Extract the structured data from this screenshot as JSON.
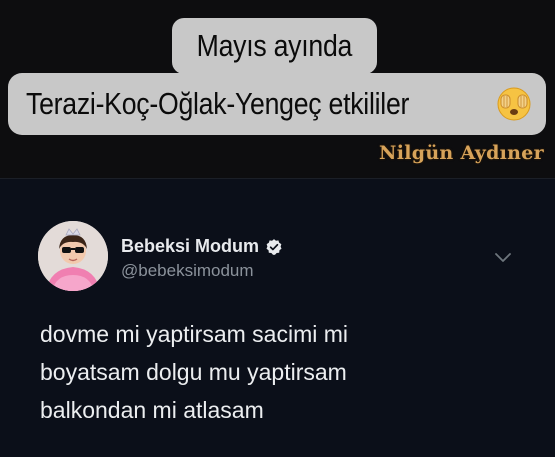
{
  "caption": {
    "line1": "Mayıs ayında",
    "line2": "Terazi-Koç-Oğlak-Yengeç etkililer",
    "emoji_icon": "face-with-hands-over-eyes-icon"
  },
  "watermark": "Nilgün Aydıner",
  "tweet": {
    "user_name": "Bebeksi Modum",
    "user_handle": "@bebeksimodum",
    "verified_icon": "verified-badge-icon",
    "menu_icon": "chevron-down-icon",
    "body_lines": [
      "dovme mi yaptirsam sacimi mi",
      "boyatsam dolgu mu yaptirsam",
      "balkondan mi atlasam"
    ]
  },
  "colors": {
    "background": "#0d0d0f",
    "caption_bg": "#c8c8c8",
    "watermark": "#d7a35a",
    "card_bg": "#0b0f19",
    "text_primary": "#eceef0",
    "text_secondary": "#8b929b"
  }
}
